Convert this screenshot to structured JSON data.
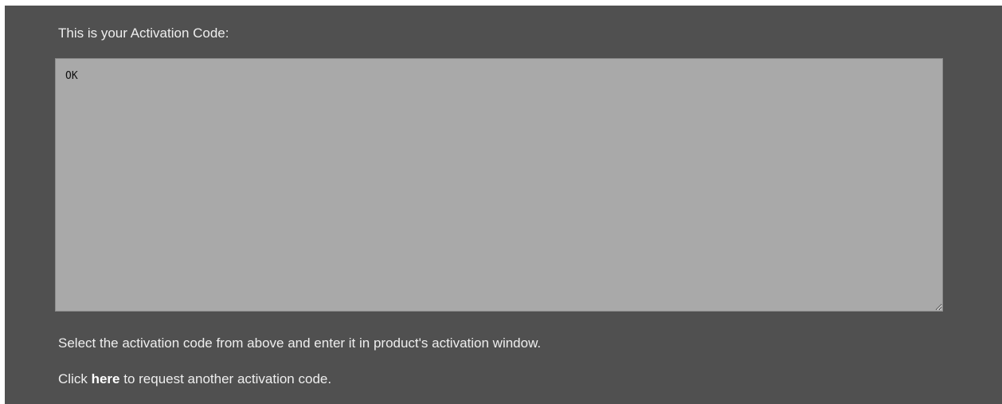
{
  "activation": {
    "heading": "This is your Activation Code:",
    "code_value": "OK",
    "instructions": "Select the activation code from above and enter it in product's activation window.",
    "request_prefix": "Click",
    "request_link": "here",
    "request_suffix": "to request another activation code."
  },
  "colors": {
    "panel_background": "#505050",
    "code_box_background": "#a9a9a9",
    "text": "#eeeeee"
  }
}
